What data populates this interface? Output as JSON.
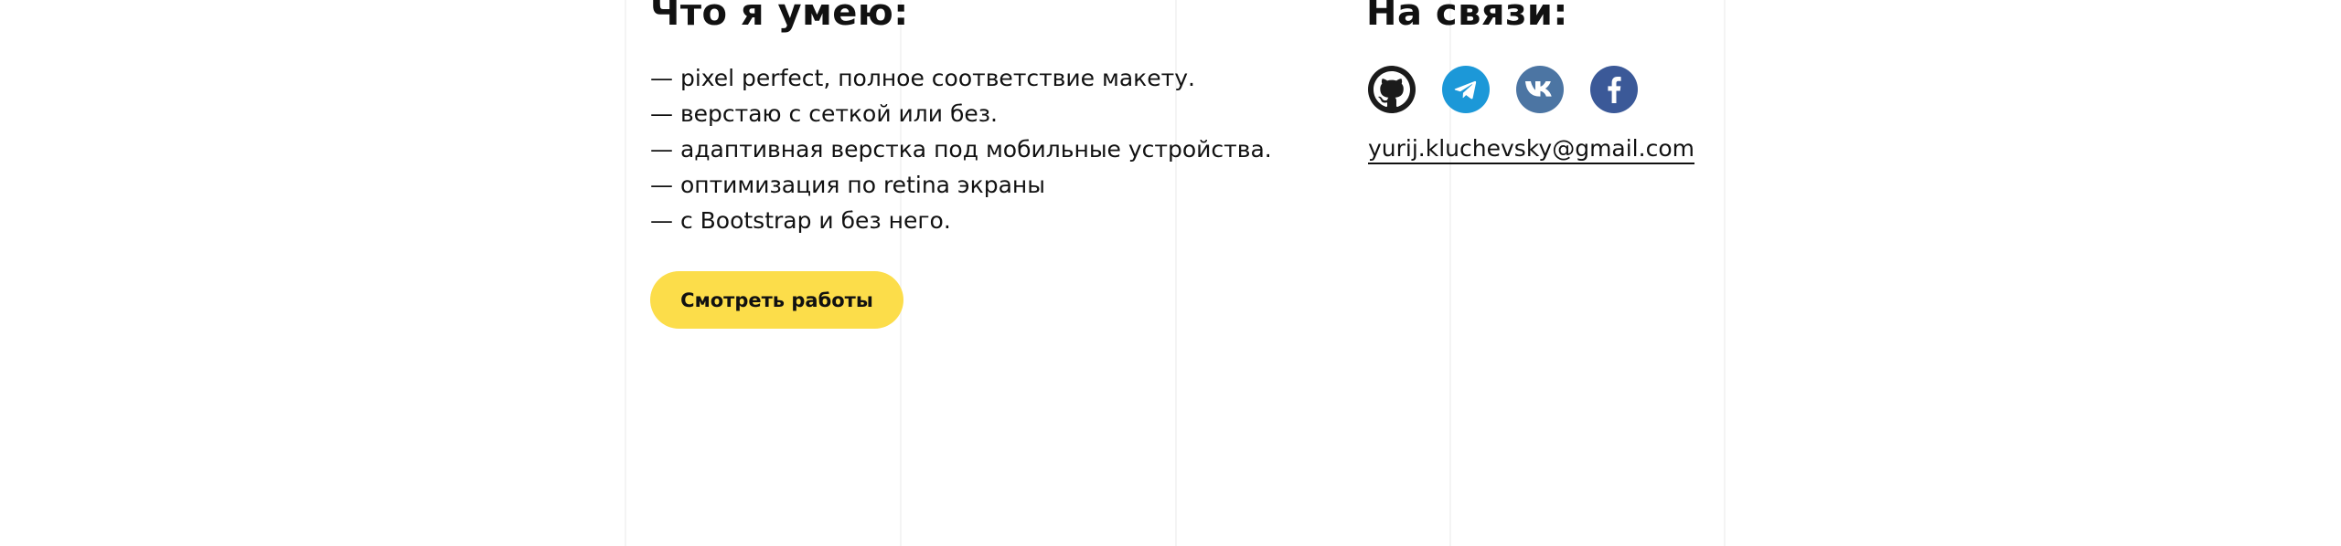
{
  "skills": {
    "title": "Что я умею:",
    "items": [
      "— pixel perfect, полное соответствие макету.",
      "— верстаю с сеткой или без.",
      "— адаптивная верстка под мобильные устройства.",
      "— оптимизация по retina экраны",
      "— с Bootstrap и без него."
    ],
    "cta_label": "Смотреть работы"
  },
  "contacts": {
    "title": "На связи:",
    "socials": [
      "github-icon",
      "telegram-icon",
      "vk-icon",
      "facebook-icon"
    ],
    "email": "yurij.kluchevsky@gmail.com"
  },
  "colors": {
    "accent": "#fcdd4a",
    "github": "#1b1b1b",
    "telegram": "#1c98d8",
    "vk": "#4c75a3",
    "facebook": "#3b5998"
  }
}
